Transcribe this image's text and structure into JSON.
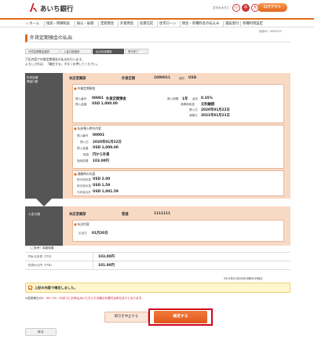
{
  "header": {
    "bank_name": "あいち銀行",
    "font_size_label": "文字の大きさ",
    "font_sizes": [
      "小",
      "中",
      "大"
    ],
    "logout": "ログアウト"
  },
  "nav": {
    "items": [
      "ホーム",
      "残高・明細照会",
      "振込・振替",
      "定期預金",
      "外貨預金",
      "投資信託",
      "住宅ローン",
      "税金・各種料金の払込み",
      "諸届受付",
      "各種利用設定"
    ]
  },
  "screen_id": "画面ID：BGD003",
  "page_title": "外貨定期預金の払出",
  "steps": [
    "外貨定期預金選択",
    "入金口座選択",
    "払出内容確認",
    "受付完了"
  ],
  "instructions": {
    "line1": "下記内容で外貨定期預金の払出を行います。",
    "line2": "よろしければ、「確定する」ボタンを押してください。"
  },
  "card1": {
    "side_label_1": "外貨定期",
    "side_label_2": "預金口座",
    "branch": "本店営業部",
    "account_type": "外貨定期",
    "account_number": "1000011",
    "currency_label": "通貨",
    "currency": "USD",
    "deposit_box": {
      "title": "外貨定期預金",
      "deposit_no_label": "預入番号",
      "deposit_no": "00001",
      "deposit_type": "外貨定期預金",
      "amount_label": "預入金額",
      "amount": "USD 1,000.00",
      "term_label": "預入期間",
      "term": "1年",
      "rate_label": "金利",
      "rate": "0.35%",
      "method_label": "満期時取扱",
      "method": "元利継続",
      "start_label": "預入日",
      "start": "2020年01月22日",
      "maturity_label": "満期日",
      "maturity": "2021年01月21日"
    },
    "payout_box": {
      "title": "払戻預入時の内容",
      "deposit_no_label": "預入番号",
      "deposit_no": "00001",
      "start_label": "預入日",
      "start": "2020年01月22日",
      "amount_label": "預入金額",
      "amount": "USD 1,000.00",
      "method_label": "取扱",
      "method": "円から外貨",
      "rate_label": "適用相場",
      "rate": "103.00円"
    },
    "interest_box": {
      "title": "満期時の内容",
      "pretax_label": "税引前利息",
      "pretax": "USD 2.00",
      "posttax_label": "税引後利息",
      "posttax": "USD 1.59",
      "total_label": "元利金合計",
      "total": "USD 1,001.59"
    }
  },
  "card2": {
    "side_label": "入金口座",
    "branch": "本店営業部",
    "account_type": "普通",
    "account_number": "1111111",
    "box_title": "払出内容",
    "date_label": "払出日",
    "date": "01月20日"
  },
  "rates": {
    "title": "（ご参考）為替相場",
    "rows": [
      {
        "label": "円から外貨（TTS）",
        "value": "103.00円"
      },
      {
        "label": "外貨から円（TTB）",
        "value": "101.00円"
      }
    ]
  },
  "timestamp": "2021年01月20日08時30分時点",
  "confirm_label": "上記の内容で確定しました。",
  "note": {
    "prefix": "※翌営業日の",
    "highlight": "0：00～15：00までにお申込みいただいたお取引の受付は本日までとなります。",
    "suffix": ""
  },
  "buttons": {
    "cancel": "取引を中止する",
    "confirm": "確定する",
    "back": "戻る"
  },
  "colors": {
    "accent": "#e36a1a",
    "card_bg": "#f8d9c4",
    "side_bg": "#555555",
    "highlight_red": "#d0021b"
  }
}
